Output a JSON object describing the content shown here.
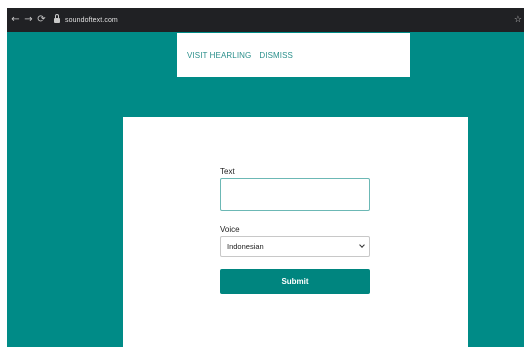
{
  "browser": {
    "url": "soundoftext.com",
    "icons": [
      "arrow-left-icon",
      "arrow-right-icon",
      "reload-icon",
      "lock-icon",
      "star-icon"
    ]
  },
  "banner": {
    "visit_label": "VISIT HEARLING",
    "dismiss_label": "DISMISS"
  },
  "form": {
    "text_label": "Text",
    "text_value": "",
    "voice_label": "Voice",
    "voice_selected": "Indonesian",
    "submit_label": "Submit"
  },
  "colors": {
    "background": "#008b87",
    "accent": "#00857f",
    "chrome": "#202124"
  }
}
